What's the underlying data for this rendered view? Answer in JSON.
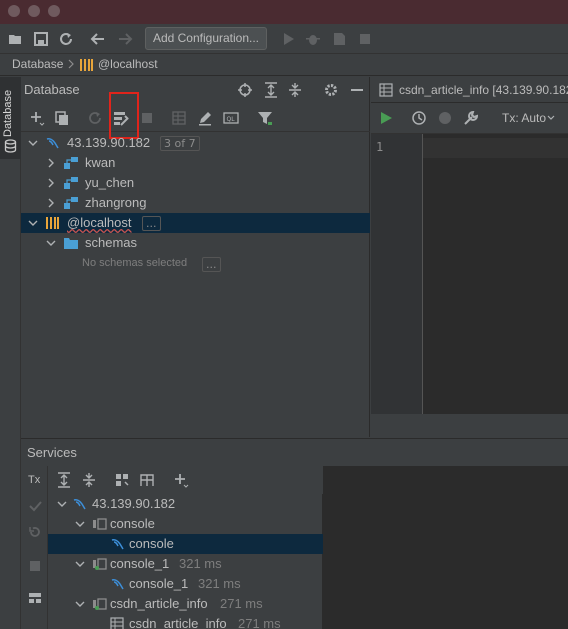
{
  "toolbar": {
    "add_configuration_label": "Add Configuration..."
  },
  "breadcrumb": {
    "root": "Database",
    "current": "@localhost"
  },
  "stripe": {
    "label": "Database"
  },
  "database_panel": {
    "title": "Database",
    "tree": [
      {
        "label": "43.139.90.182",
        "badge": "3 of 7"
      },
      {
        "label": "kwan"
      },
      {
        "label": "yu_chen"
      },
      {
        "label": "zhangrong"
      },
      {
        "label": "@localhost",
        "badge": "..."
      },
      {
        "label": "schemas"
      },
      {
        "label": "No schemas selected",
        "badge": "..."
      }
    ]
  },
  "editor": {
    "tab_title": "csdn_article_info [43.139.90.182",
    "tx_mode": "Tx: Auto",
    "line_number": "1"
  },
  "services": {
    "title": "Services",
    "tx_label": "Tx",
    "tree": [
      {
        "label": "43.139.90.182"
      },
      {
        "label": "console"
      },
      {
        "label": "console"
      },
      {
        "label": "console_1",
        "time": "321 ms"
      },
      {
        "label": "console_1",
        "time": "321 ms"
      },
      {
        "label": "csdn_article_info",
        "time": "271 ms"
      },
      {
        "label": "csdn_article_info",
        "time": "271 ms"
      }
    ]
  },
  "colors": {
    "highlight_box": "#e0241b",
    "mysql_icon": "#3d8fd9",
    "schema_icon": "#4a9fd4",
    "localhost_icon": "#e8a53a",
    "selection": "#0d293e",
    "run_green": "#499c54"
  }
}
